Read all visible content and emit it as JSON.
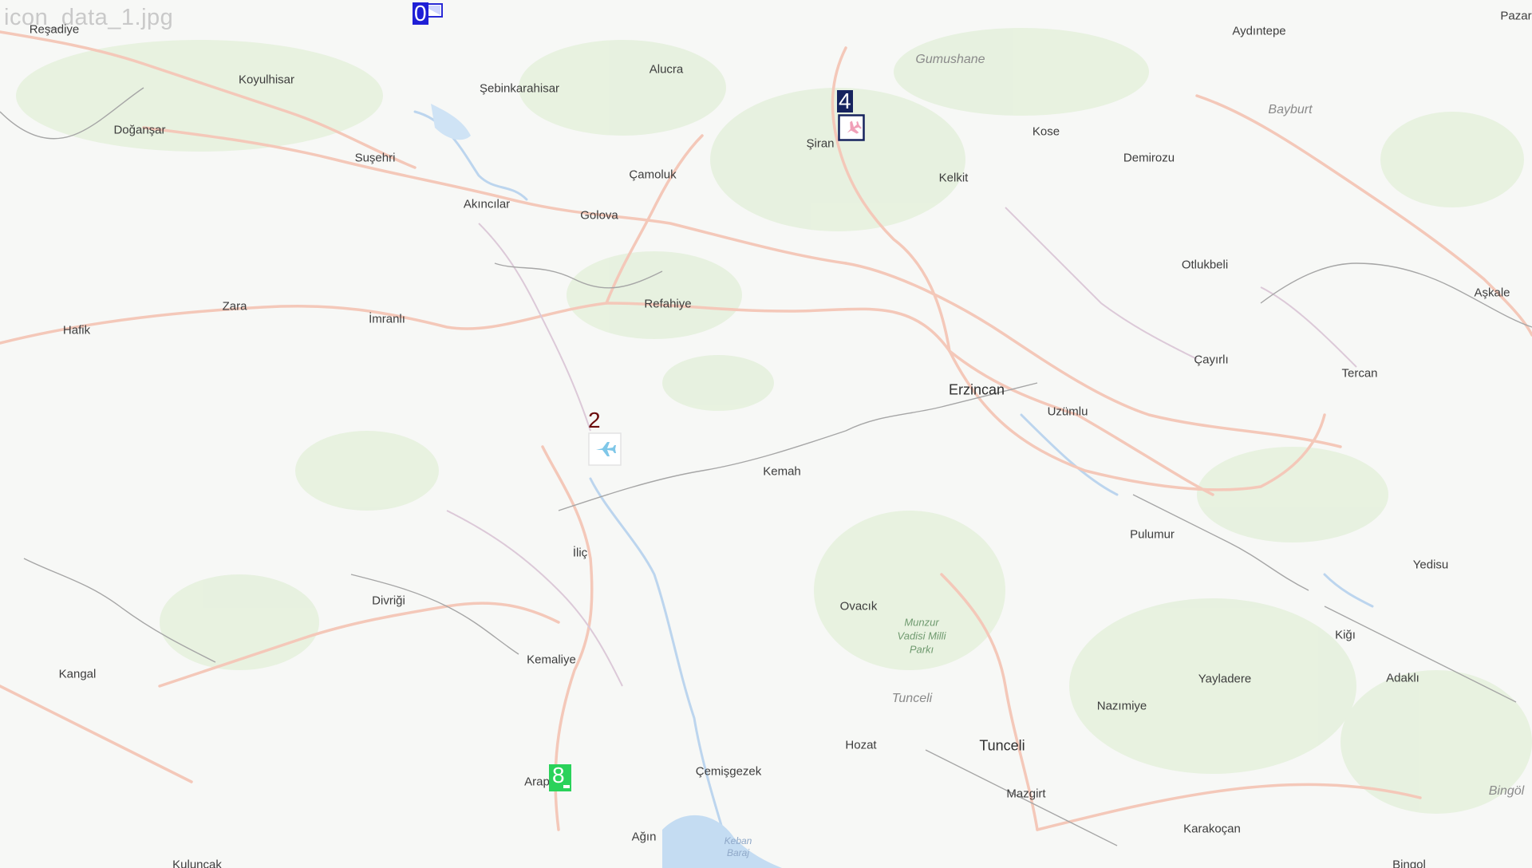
{
  "caption": "icon_data_1.jpg",
  "places": [
    {
      "id": "resadiye",
      "name": "Reşadiye",
      "kind": "town"
    },
    {
      "id": "koyulhisar",
      "name": "Koyulhisar",
      "kind": "town"
    },
    {
      "id": "dogansar",
      "name": "Doğanşar",
      "kind": "town"
    },
    {
      "id": "sebinkarahisar",
      "name": "Şebinkarahisar",
      "kind": "town"
    },
    {
      "id": "alucra",
      "name": "Alucra",
      "kind": "town"
    },
    {
      "id": "susehri",
      "name": "Suşehri",
      "kind": "town"
    },
    {
      "id": "camoluk",
      "name": "Çamoluk",
      "kind": "town"
    },
    {
      "id": "akincilar",
      "name": "Akıncılar",
      "kind": "town"
    },
    {
      "id": "golova",
      "name": "Golova",
      "kind": "town"
    },
    {
      "id": "gumushane",
      "name": "Gumushane",
      "kind": "region"
    },
    {
      "id": "siran",
      "name": "Şiran",
      "kind": "town"
    },
    {
      "id": "kose",
      "name": "Kose",
      "kind": "town"
    },
    {
      "id": "kelkit",
      "name": "Kelkit",
      "kind": "town"
    },
    {
      "id": "demirozu",
      "name": "Demirozu",
      "kind": "town"
    },
    {
      "id": "aydintepe",
      "name": "Aydıntepe",
      "kind": "town"
    },
    {
      "id": "bayburt",
      "name": "Bayburt",
      "kind": "region"
    },
    {
      "id": "pazar",
      "name": "Pazar",
      "kind": "town"
    },
    {
      "id": "otlukbeli",
      "name": "Otlukbeli",
      "kind": "town"
    },
    {
      "id": "askale",
      "name": "Aşkale",
      "kind": "town"
    },
    {
      "id": "zara",
      "name": "Zara",
      "kind": "town"
    },
    {
      "id": "hafik",
      "name": "Hafik",
      "kind": "town"
    },
    {
      "id": "imranli",
      "name": "İmranlı",
      "kind": "town"
    },
    {
      "id": "refahiye",
      "name": "Refahiye",
      "kind": "town"
    },
    {
      "id": "cayirli",
      "name": "Çayırlı",
      "kind": "town"
    },
    {
      "id": "tercan",
      "name": "Tercan",
      "kind": "town"
    },
    {
      "id": "erzincan",
      "name": "Erzincan",
      "kind": "city"
    },
    {
      "id": "uzumlu",
      "name": "Uzümlu",
      "kind": "town"
    },
    {
      "id": "kemah",
      "name": "Kemah",
      "kind": "town"
    },
    {
      "id": "pulumur",
      "name": "Pulumur",
      "kind": "town"
    },
    {
      "id": "ilic",
      "name": "İliç",
      "kind": "town"
    },
    {
      "id": "divrigi",
      "name": "Divriği",
      "kind": "town"
    },
    {
      "id": "yedisu",
      "name": "Yedisu",
      "kind": "town"
    },
    {
      "id": "ovacik",
      "name": "Ovacık",
      "kind": "town"
    },
    {
      "id": "munzur",
      "name": "Munzur\nVadisi Milli\nParkı",
      "kind": "park"
    },
    {
      "id": "kigi",
      "name": "Kiğı",
      "kind": "town"
    },
    {
      "id": "kangal",
      "name": "Kangal",
      "kind": "town"
    },
    {
      "id": "kemaliye",
      "name": "Kemaliye",
      "kind": "town"
    },
    {
      "id": "yayladere",
      "name": "Yayladere",
      "kind": "town"
    },
    {
      "id": "adakli",
      "name": "Adaklı",
      "kind": "town"
    },
    {
      "id": "tunceli-region",
      "name": "Tunceli",
      "kind": "region"
    },
    {
      "id": "nazimiye",
      "name": "Nazımiye",
      "kind": "town"
    },
    {
      "id": "hozat",
      "name": "Hozat",
      "kind": "town"
    },
    {
      "id": "tunceli",
      "name": "Tunceli",
      "kind": "city"
    },
    {
      "id": "cemisgezek",
      "name": "Çemişgezek",
      "kind": "town"
    },
    {
      "id": "arapgir",
      "name": "Arap",
      "kind": "town"
    },
    {
      "id": "mazgirt",
      "name": "Mazgirt",
      "kind": "town"
    },
    {
      "id": "bingol-region",
      "name": "Bingöl",
      "kind": "region"
    },
    {
      "id": "agin",
      "name": "Ağın",
      "kind": "town"
    },
    {
      "id": "keban",
      "name": "Keban\nBaraj",
      "kind": "lake"
    },
    {
      "id": "karakocan",
      "name": "Karakoçan",
      "kind": "town"
    },
    {
      "id": "kulancak",
      "name": "Kuluncak",
      "kind": "town"
    },
    {
      "id": "bingol",
      "name": "Bingol",
      "kind": "town"
    }
  ],
  "markers": [
    {
      "id": "0",
      "label": "0",
      "icon": "flag-icon",
      "color": "#1f1fd6"
    },
    {
      "id": "2",
      "label": "2",
      "icon": "airplane-icon",
      "color": "#6b0c0c"
    },
    {
      "id": "4",
      "label": "4",
      "icon": "airport-icon",
      "color": "#16235e"
    },
    {
      "id": "8",
      "label": "8",
      "icon": "dock-icon",
      "color": "#2ad25a"
    }
  ],
  "colors": {
    "land": "#f7f8f6",
    "forest": "#e4f0dc",
    "road": "#f3c4b6",
    "river": "#b9d3ec",
    "border": "#9a9a9a",
    "province-border": "#d9c7d4"
  }
}
